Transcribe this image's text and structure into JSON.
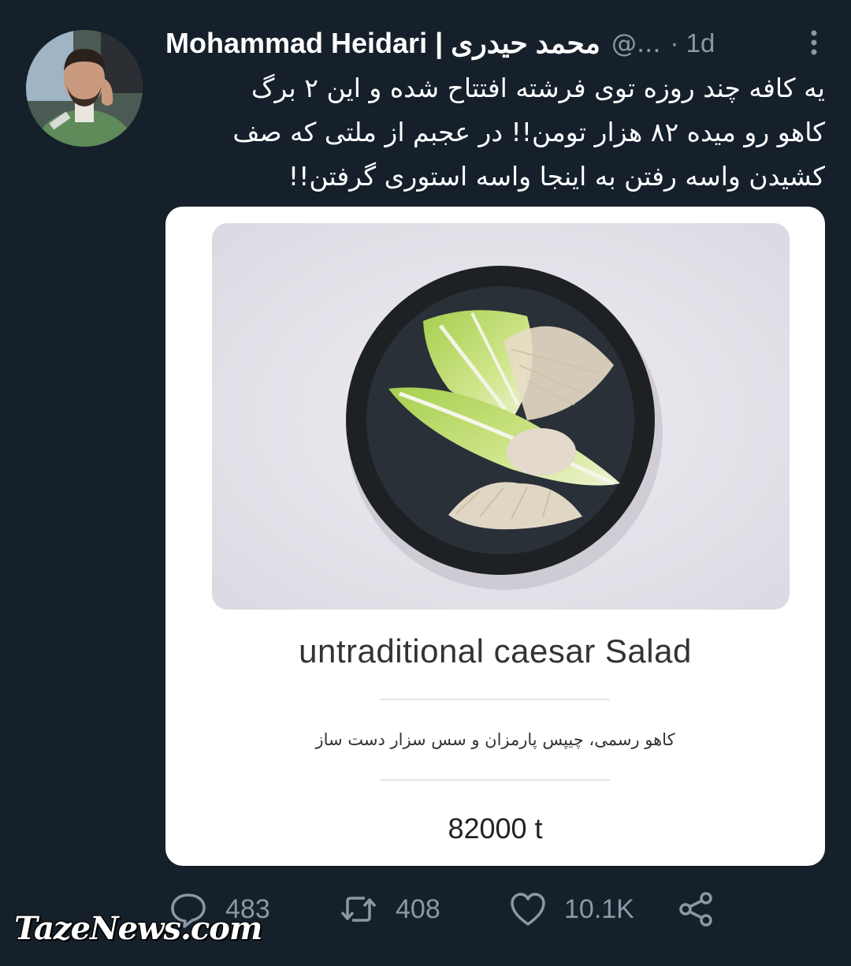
{
  "tweet": {
    "author_name": "Mohammad Heidari | محمد حیدری",
    "handle": "@...",
    "time": "· 1d",
    "text_lines": [
      "یه کافه چند روزه توی فرشته افتتاح شده و این ۲ برگ",
      "کاهو رو میده ۸۲ هزار تومن!! در عجبم از ملتی که صف",
      "کشیدن واسه رفتن به اینجا واسه استوری گرفتن!!"
    ]
  },
  "card": {
    "dish_title": "untraditional caesar Salad",
    "description": "کاهو رسمی، چیپس پارمزان و سس سزار دست ساز",
    "price": "82000 t"
  },
  "actions": {
    "replies": "483",
    "retweets": "408",
    "likes": "10.1K"
  },
  "icons": [
    "more-icon",
    "reply-icon",
    "retweet-icon",
    "like-icon",
    "share-icon"
  ],
  "colors": {
    "background": "#15202b",
    "secondary_text": "#8b98a5",
    "card_background": "#ffffff"
  },
  "watermark": "TazeNews.com"
}
